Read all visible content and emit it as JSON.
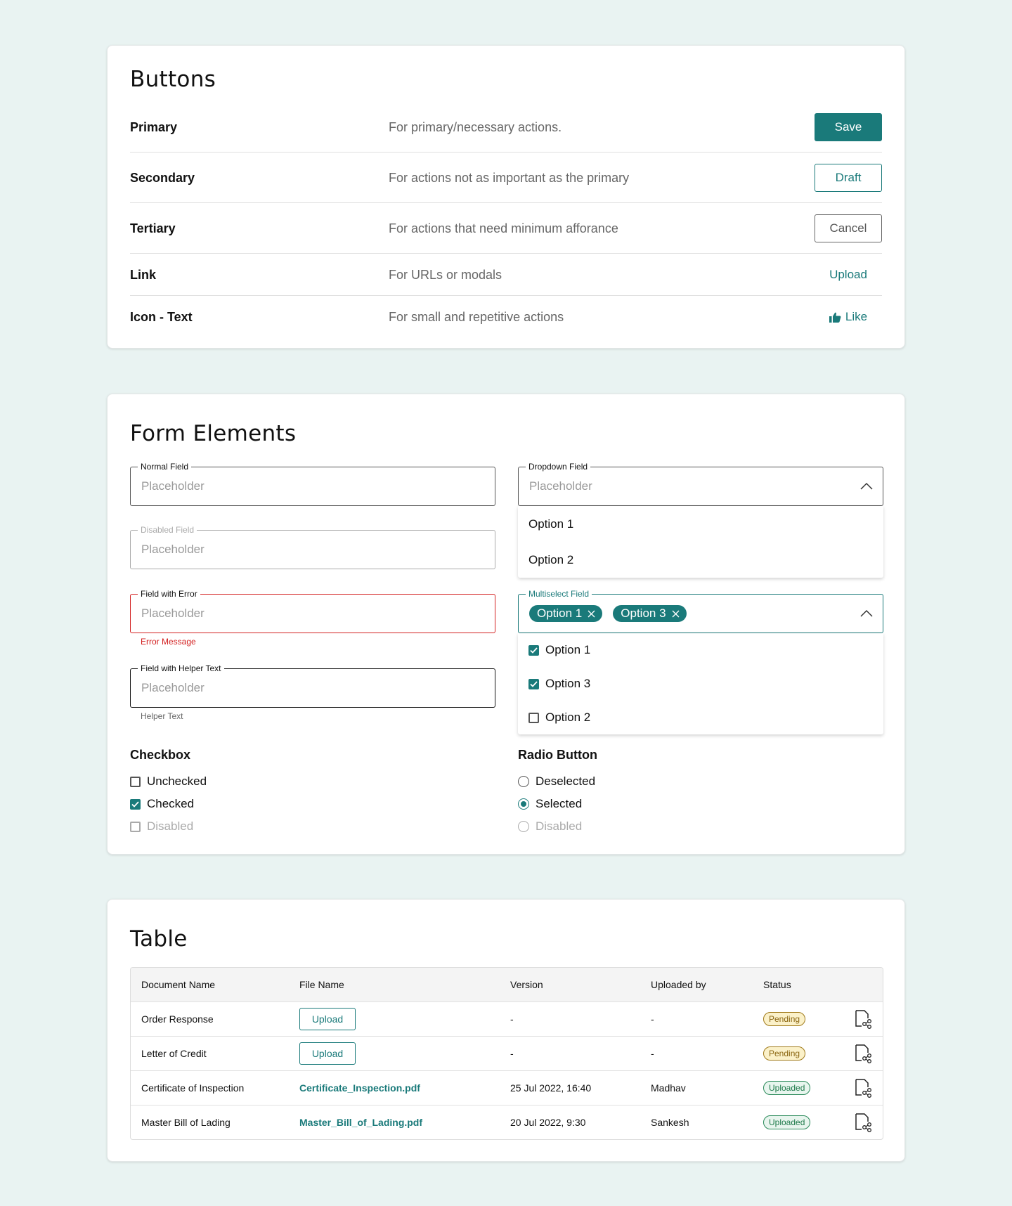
{
  "colors": {
    "accent": "#1a7a7a",
    "error": "#d32020",
    "background": "#e9f3f2",
    "pending": "#fbf1c9",
    "uploaded": "#e8f5ee"
  },
  "buttons": {
    "title": "Buttons",
    "rows": [
      {
        "name": "Primary",
        "description": "For primary/necessary actions.",
        "action": "Save"
      },
      {
        "name": "Secondary",
        "description": "For actions not as important as the primary",
        "action": "Draft"
      },
      {
        "name": "Tertiary",
        "description": "For actions that need minimum afforance",
        "action": "Cancel"
      },
      {
        "name": "Link",
        "description": "For URLs or modals",
        "action": "Upload"
      },
      {
        "name": "Icon - Text",
        "description": "For small and repetitive actions",
        "action": "Like",
        "icon": "thumbs-up-icon"
      }
    ]
  },
  "form": {
    "title": "Form Elements",
    "normal_field": {
      "label": "Normal Field",
      "placeholder": "Placeholder"
    },
    "disabled_field": {
      "label": "Disabled Field",
      "placeholder": "Placeholder"
    },
    "error_field": {
      "label": "Field with Error",
      "placeholder": "Placeholder",
      "error": "Error Message"
    },
    "helper_field": {
      "label": "Field with Helper Text",
      "placeholder": "Placeholder",
      "helper": "Helper Text"
    },
    "dropdown_field": {
      "label": "Dropdown Field",
      "placeholder": "Placeholder",
      "options": [
        "Option 1",
        "Option 2"
      ]
    },
    "multiselect_field": {
      "label": "Multiselect Field",
      "chips": [
        "Option 1",
        "Option 3"
      ],
      "options": [
        {
          "label": "Option 1",
          "checked": true
        },
        {
          "label": "Option 3",
          "checked": true
        },
        {
          "label": "Option 2",
          "checked": false
        }
      ]
    },
    "checkbox": {
      "title": "Checkbox",
      "items": [
        {
          "label": "Unchecked",
          "state": "unchecked"
        },
        {
          "label": "Checked",
          "state": "checked"
        },
        {
          "label": "Disabled",
          "state": "disabled"
        }
      ]
    },
    "radio": {
      "title": "Radio Button",
      "items": [
        {
          "label": "Deselected",
          "state": "deselected"
        },
        {
          "label": "Selected",
          "state": "selected"
        },
        {
          "label": "Disabled",
          "state": "disabled"
        }
      ]
    }
  },
  "table": {
    "title": "Table",
    "columns": [
      "Document Name",
      "File Name",
      "Version",
      "Uploaded by",
      "Status"
    ],
    "rows": [
      {
        "document": "Order Response",
        "file": "Upload",
        "file_is_button": true,
        "version": "-",
        "uploaded_by": "-",
        "status": "Pending"
      },
      {
        "document": "Letter of Credit",
        "file": "Upload",
        "file_is_button": true,
        "version": "-",
        "uploaded_by": "-",
        "status": "Pending"
      },
      {
        "document": "Certificate of Inspection",
        "file": "Certificate_Inspection.pdf",
        "file_is_button": false,
        "version": "25 Jul 2022, 16:40",
        "uploaded_by": "Madhav",
        "status": "Uploaded"
      },
      {
        "document": "Master Bill of Lading",
        "file": "Master_Bill_of_Lading.pdf",
        "file_is_button": false,
        "version": "20 Jul 2022, 9:30",
        "uploaded_by": "Sankesh",
        "status": "Uploaded"
      }
    ]
  }
}
